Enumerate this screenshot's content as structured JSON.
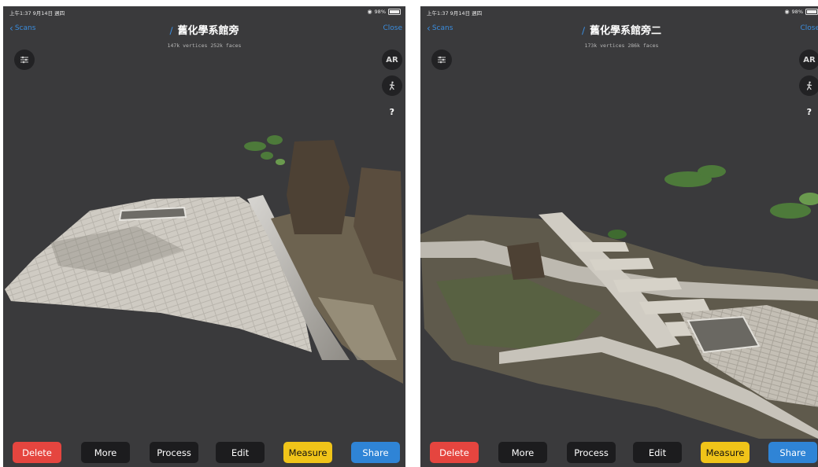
{
  "screens": [
    {
      "status": {
        "time": "上午1:37  9月14日 週四",
        "battery": "98%"
      },
      "nav": {
        "back": "Scans",
        "title": "舊化學系館旁",
        "close": "Close"
      },
      "stats": "147k vertices  252k faces",
      "controls": {
        "ar": "AR",
        "help": "?"
      },
      "toolbar": {
        "delete": "Delete",
        "more": "More",
        "process": "Process",
        "edit": "Edit",
        "measure": "Measure",
        "share": "Share"
      }
    },
    {
      "status": {
        "time": "上午1:37  9月14日 週四",
        "battery": "98%"
      },
      "nav": {
        "back": "Scans",
        "title": "舊化學系館旁二",
        "close": "Close"
      },
      "stats": "173k vertices  286k faces",
      "controls": {
        "ar": "AR",
        "help": "?"
      },
      "toolbar": {
        "delete": "Delete",
        "more": "More",
        "process": "Process",
        "edit": "Edit",
        "measure": "Measure",
        "share": "Share"
      }
    }
  ],
  "colors": {
    "accent": "#3a8dde",
    "delete": "#e5453f",
    "measure": "#f0c419",
    "share": "#2f84d6",
    "background": "#3a3a3c"
  }
}
